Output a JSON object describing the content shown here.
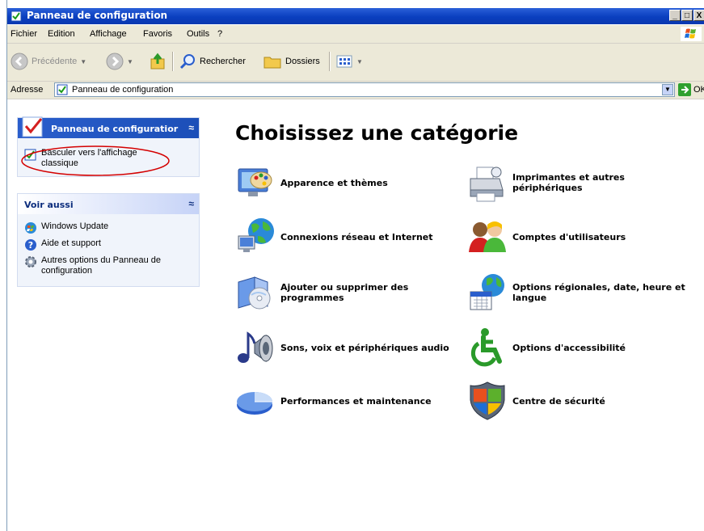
{
  "window": {
    "title": "Panneau de configuration",
    "controls": {
      "minimize": "_",
      "maximize": "□",
      "close": "X"
    }
  },
  "menu": [
    "Fichier",
    "Edition",
    "Affichage",
    "Favoris",
    "Outils",
    "?"
  ],
  "toolbar": {
    "back_label": "Précédente",
    "search_label": "Rechercher",
    "folders_label": "Dossiers"
  },
  "address": {
    "label": "Adresse",
    "value": "Panneau de configuration",
    "go_label": "OK"
  },
  "left_pane": {
    "panel_box": {
      "title": "Panneau de configuratior",
      "switch_link": [
        "Basculer vers l'affichage",
        "classique"
      ]
    },
    "see_also": {
      "title": "Voir aussi",
      "links": [
        {
          "label": [
            "Windows Update"
          ],
          "icon": "windows-update-icon"
        },
        {
          "label": [
            "Aide et support"
          ],
          "icon": "help-icon"
        },
        {
          "label": [
            "Autres options du Panneau de",
            "configuration"
          ],
          "icon": "gear-icon"
        }
      ]
    }
  },
  "main": {
    "heading": "Choisissez une catégorie",
    "categories_left": [
      {
        "label": [
          "Apparence et thèmes"
        ],
        "icon": "appearance-themes-icon"
      },
      {
        "label": [
          "Connexions réseau et Internet"
        ],
        "icon": "network-icon"
      },
      {
        "label": [
          "Ajouter ou supprimer des",
          "programmes"
        ],
        "icon": "add-remove-programs-icon"
      },
      {
        "label": [
          "Sons, voix et périphériques audio"
        ],
        "icon": "sounds-icon"
      },
      {
        "label": [
          "Performances et maintenance"
        ],
        "icon": "performance-icon"
      }
    ],
    "categories_right": [
      {
        "label": [
          "Imprimantes et autres",
          "périphériques"
        ],
        "icon": "printer-icon"
      },
      {
        "label": [
          "Comptes d'utilisateurs"
        ],
        "icon": "user-accounts-icon"
      },
      {
        "label": [
          "Options régionales, date, heure et",
          "langue"
        ],
        "icon": "regional-options-icon"
      },
      {
        "label": [
          "Options d'accessibilité"
        ],
        "icon": "accessibility-icon"
      },
      {
        "label": [
          "Centre de sécurité"
        ],
        "icon": "security-center-icon"
      }
    ]
  },
  "colors": {
    "titlebar": "#0a3fbf",
    "chrome": "#ece9d8",
    "pane_box": "#f0f4fb",
    "highlight_ellipse": "#d40000"
  }
}
